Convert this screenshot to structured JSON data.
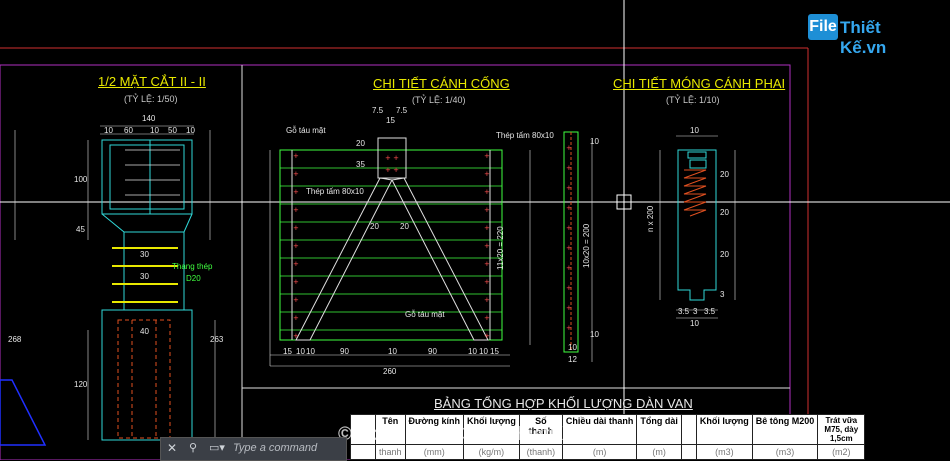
{
  "logo": {
    "file": "File",
    "rest": "Thiết Kế.vn"
  },
  "watermark": "© Copyright © FileThietKe.vn",
  "section_left": {
    "title": "1/2 MẶT CẮT II - II",
    "scale": "(TỶ LỆ: 1/50)"
  },
  "section_mid": {
    "title": "CHI TIẾT CÁNH CỐNG",
    "scale": "(TỶ LỆ: 1/40)"
  },
  "section_right": {
    "title": "CHI TIẾT MÓNG CÁNH PHAI",
    "scale": "(TỶ LỆ: 1/10)"
  },
  "left_dims": {
    "top": [
      "140",
      "10",
      "60",
      "10",
      "50",
      "10"
    ],
    "side": [
      "100",
      "45",
      "30",
      "30",
      "30",
      "40",
      "263",
      "120",
      "268"
    ],
    "rebar_note": "Thang thép",
    "rebar_size": "D20"
  },
  "mid_dims": {
    "top": [
      "7.5",
      "7.5",
      "15",
      "20",
      "35"
    ],
    "labels": [
      "Gỗ táu mặt",
      "Thép tấm 80x10",
      "Gỗ táu mặt",
      "Thép tấm 80x10"
    ],
    "diag": [
      "20",
      "20"
    ],
    "height": "11x20 = 220",
    "height2": "10x20 = 200",
    "bottom": [
      "15",
      "10",
      "10",
      "90",
      "10",
      "90",
      "10",
      "10",
      "15"
    ],
    "total": "260",
    "rhs": [
      "10",
      "10",
      "10",
      "12"
    ]
  },
  "right_dims": {
    "top": "10",
    "side": [
      "20",
      "20",
      "20",
      "3"
    ],
    "left": "n x 200",
    "bottom": [
      "3.5",
      "3",
      "3.5"
    ],
    "bottom_total": "10"
  },
  "table": {
    "title": "BẢNG TỔNG HỢP KHỐI LƯỢNG DÀN VAN",
    "headers": [
      "",
      "Tên",
      "Đường kính",
      "Khối lượng",
      "Số thanh",
      "Chiều dài thanh",
      "Tổng dài",
      "",
      "Khối lượng",
      "Bê tông M200",
      "Trát vữa M75, dày 1,5cm"
    ],
    "row1": [
      "",
      "thanh",
      "(mm)",
      "(kg/m)",
      "(thanh)",
      "(m)",
      "(m)",
      "",
      "(m3)",
      "(m3)",
      "(m2)"
    ]
  },
  "command": {
    "placeholder": "Type a command"
  }
}
